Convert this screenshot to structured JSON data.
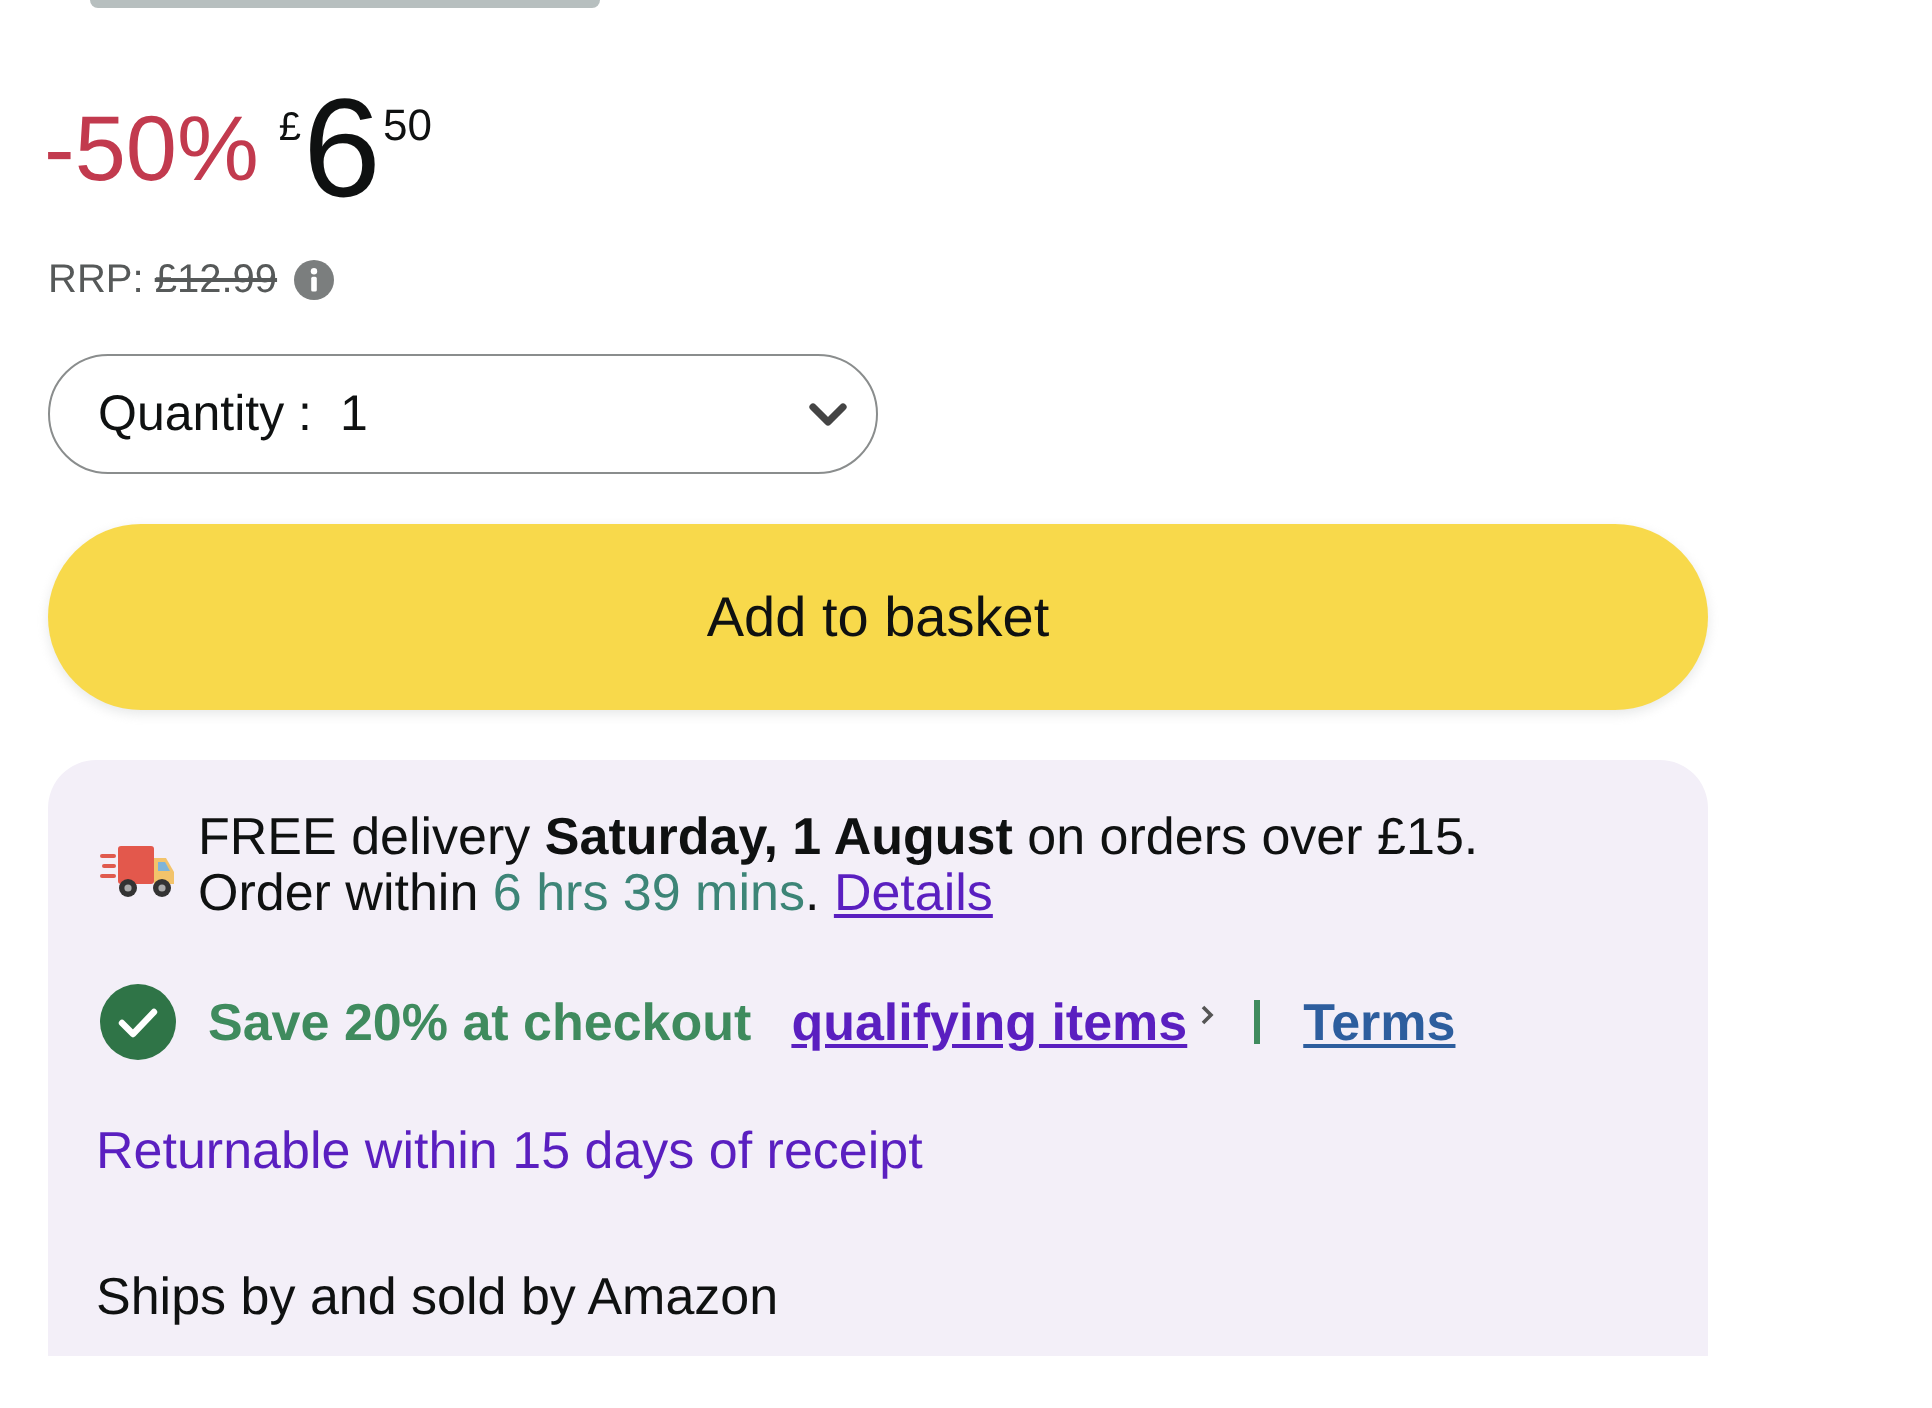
{
  "price": {
    "discount": "-50%",
    "currency": "£",
    "whole": "6",
    "fraction": "50"
  },
  "rrp": {
    "label": "RRP:",
    "value": "£12.99"
  },
  "quantity": {
    "label": "Quantity :",
    "value": "1"
  },
  "add_to_basket": {
    "label": "Add to basket"
  },
  "delivery": {
    "message": "FREE delivery **Saturday, 1 August** on orders over £15.",
    "order_prefix": "Order within",
    "countdown": "6 hrs 39 mins",
    "order_suffix": ".",
    "link": "Details"
  },
  "savings": {
    "text": "Save 20% at checkout",
    "link": "qualifying items",
    "terms_link": "Terms"
  },
  "returns": "Returnable within 15 days of receipt",
  "seller": "Ships by and sold by Amazon"
}
